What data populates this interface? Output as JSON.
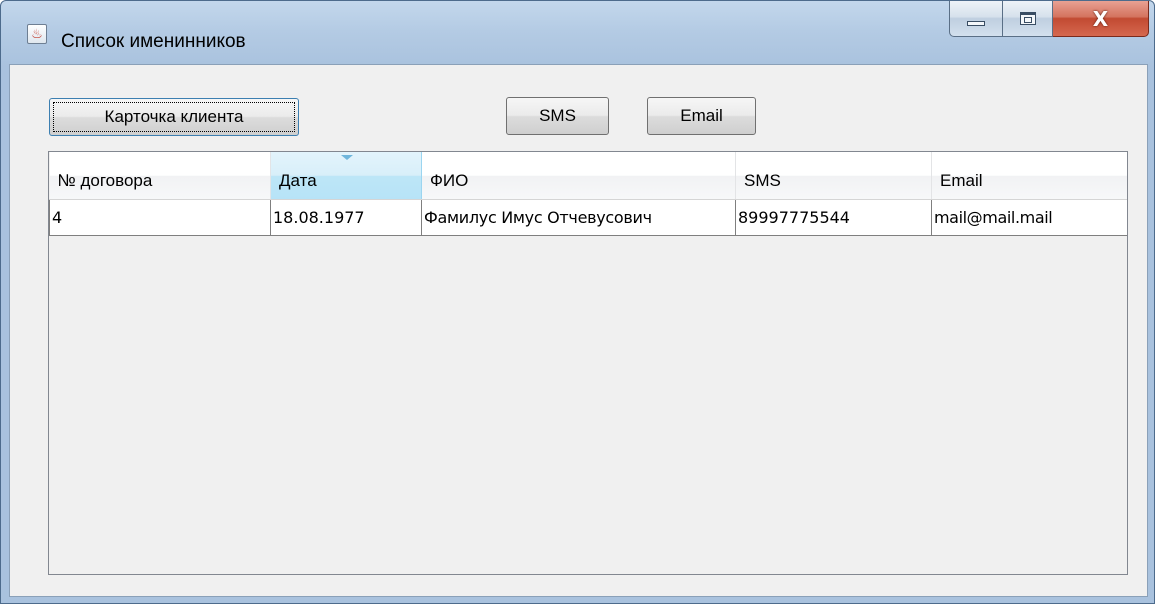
{
  "window": {
    "title": "Список именинников",
    "app_icon": "java-cup-icon",
    "controls": {
      "minimize": "minimize-icon",
      "maximize": "maximize-icon",
      "close": "close-icon",
      "close_glyph": "X"
    }
  },
  "toolbar": {
    "client_card_label": "Карточка клиента",
    "sms_label": "SMS",
    "email_label": "Email"
  },
  "table": {
    "columns": [
      "№ договора",
      "Дата",
      "ФИО",
      "SMS",
      "Email"
    ],
    "sorted_column": "Дата",
    "rows": [
      {
        "contract": "4",
        "date": "18.08.1977",
        "fio": "Фамилус Имус Отчевусович",
        "sms": "89997775544",
        "email": "mail@mail.mail"
      }
    ]
  },
  "colors": {
    "title_gradient": "#b4cbe4",
    "client_background": "#f0f0f0",
    "sorted_header": "#bde6f7",
    "close_button": "#c24a32"
  }
}
